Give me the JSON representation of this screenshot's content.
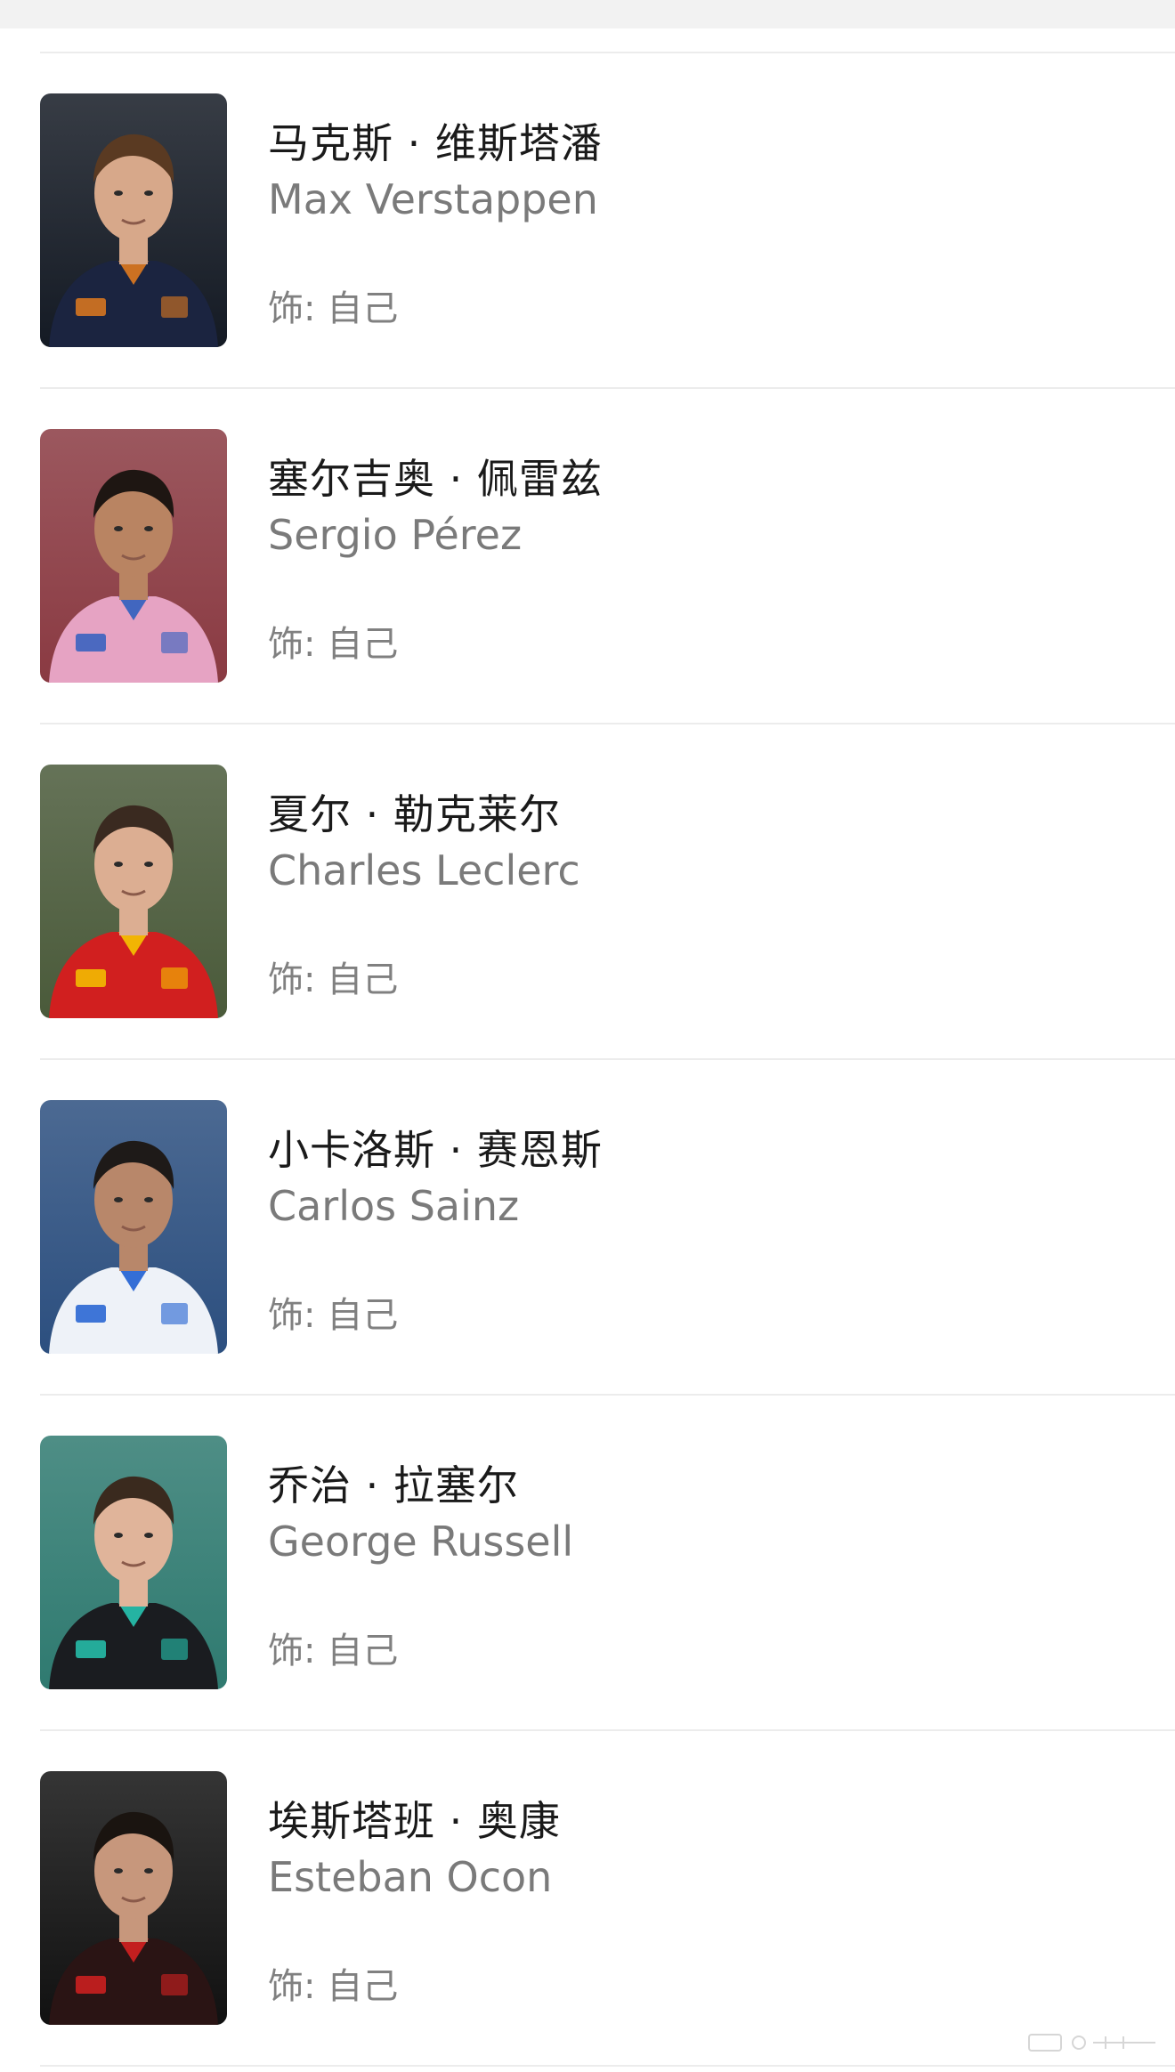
{
  "cast": [
    {
      "name_zh": "马克斯 · 维斯塔潘",
      "name_en": "Max Verstappen",
      "role": "饰: 自己",
      "photo": "driver-portrait-red-bull",
      "photo_colors": {
        "bg": "#141a24",
        "suit": "#1b2440",
        "accent": "#e07a1f",
        "skin": "#d7a88a",
        "hair": "#5a3a22"
      }
    },
    {
      "name_zh": "塞尔吉奥 · 佩雷兹",
      "name_en": "Sergio Pérez",
      "role": "饰: 自己",
      "photo": "driver-portrait-bwt",
      "photo_colors": {
        "bg": "#8a3a42",
        "suit": "#e6a3c3",
        "accent": "#2f5fbf",
        "skin": "#b98462",
        "hair": "#1e1612"
      }
    },
    {
      "name_zh": "夏尔 · 勒克莱尔",
      "name_en": "Charles Leclerc",
      "role": "饰: 自己",
      "photo": "driver-portrait-ferrari",
      "photo_colors": {
        "bg": "#4a5a3a",
        "suit": "#d11f1f",
        "accent": "#f5c400",
        "skin": "#dcae92",
        "hair": "#3a2a20"
      }
    },
    {
      "name_zh": "小卡洛斯 · 赛恩斯",
      "name_en": "Carlos Sainz",
      "role": "饰: 自己",
      "photo": "driver-portrait-williams",
      "photo_colors": {
        "bg": "#2c4f7f",
        "suit": "#eef2f8",
        "accent": "#1f5fd1",
        "skin": "#b8876a",
        "hair": "#1e1a18"
      }
    },
    {
      "name_zh": "乔治 · 拉塞尔",
      "name_en": "George Russell",
      "role": "饰: 自己",
      "photo": "driver-portrait-mercedes",
      "photo_colors": {
        "bg": "#2f7a70",
        "suit": "#1a1c20",
        "accent": "#27c4b0",
        "skin": "#e0b49a",
        "hair": "#3a2a1e"
      }
    },
    {
      "name_zh": "埃斯塔班 · 奥康",
      "name_en": "Esteban Ocon",
      "role": "饰: 自己",
      "photo": "driver-portrait-haas",
      "photo_colors": {
        "bg": "#111111",
        "suit": "#2a1414",
        "accent": "#d42020",
        "skin": "#c7977c",
        "hair": "#1a1410"
      }
    }
  ]
}
